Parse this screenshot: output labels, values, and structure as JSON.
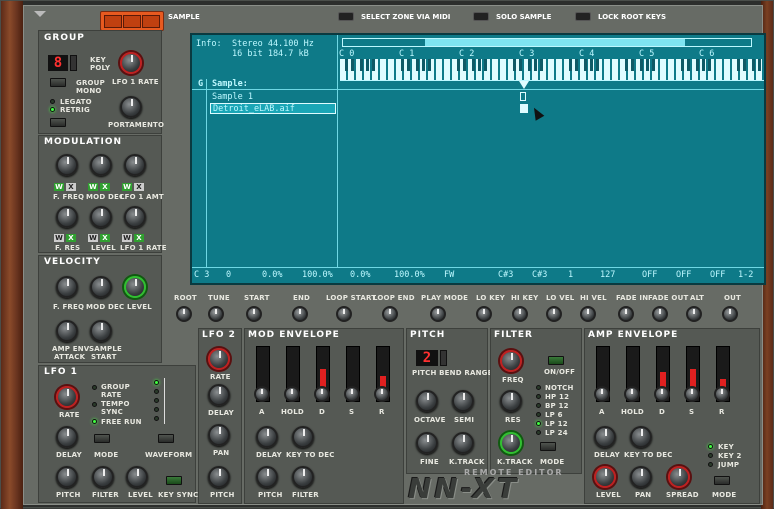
{
  "topbar": {
    "tab_label": "SAMPLE",
    "select_zone_via_midi": "SELECT ZONE VIA MIDI",
    "solo_sample": "SOLO SAMPLE",
    "lock_root_keys": "LOCK ROOT KEYS"
  },
  "group": {
    "title": "GROUP",
    "key_poly_value": "8",
    "key_label": "KEY",
    "poly_label": "POLY",
    "lfo1_rate": "LFO 1 RATE",
    "group_mono_line1": "GROUP",
    "group_mono_line2": "MONO",
    "legato": "LEGATO",
    "retrig": "RETRIG",
    "portamento": "PORTAMENTO"
  },
  "modulation": {
    "title": "MODULATION",
    "row1": [
      "F. FREQ",
      "MOD DEC",
      "LFO 1 AMT"
    ],
    "row2": [
      "F. RES",
      "LEVEL",
      "LFO 1 RATE"
    ],
    "w": "W",
    "x": "X"
  },
  "velocity": {
    "title": "VELOCITY",
    "row1": [
      "F. FREQ",
      "MOD DEC",
      "LEVEL"
    ],
    "amp_env_attack_1": "AMP ENV",
    "amp_env_attack_2": "ATTACK",
    "sample_start_1": "SAMPLE",
    "sample_start_2": "START"
  },
  "lfo1": {
    "title": "LFO 1",
    "group_rate_1": "GROUP",
    "group_rate_2": "RATE",
    "tempo_sync_1": "TEMPO",
    "tempo_sync_2": "SYNC",
    "free_run": "FREE RUN",
    "rate": "RATE",
    "delay": "DELAY",
    "mode": "MODE",
    "waveform": "WAVEFORM",
    "pitch": "PITCH",
    "filter": "FILTER",
    "level": "LEVEL",
    "key_sync": "KEY SYNC"
  },
  "screen": {
    "info_label": "Info:",
    "info_line1": "Stereo 44.100 Hz",
    "info_line2": "16 bit 184.7 kB",
    "g_label": "G",
    "sample_header": "Sample:",
    "samples": [
      "Sample 1",
      "Detroit_eLAB.aif"
    ],
    "octaves": [
      "C 0",
      "C 1",
      "C 2",
      "C 3",
      "C 4",
      "C 5",
      "C 6"
    ],
    "status": [
      "C 3",
      "0",
      "0.0%",
      "100.0%",
      "0.0%",
      "100.0%",
      "FW",
      "C#3",
      "C#3",
      "1",
      "127",
      "OFF",
      "OFF",
      "OFF",
      "1-2"
    ]
  },
  "params": [
    "ROOT",
    "TUNE",
    "START",
    "END",
    "LOOP START",
    "LOOP END",
    "PLAY MODE",
    "LO KEY",
    "HI KEY",
    "LO VEL",
    "HI VEL",
    "FADE IN",
    "FADE OUT",
    "ALT",
    "OUT"
  ],
  "lfo2": {
    "title": "LFO 2",
    "rate": "RATE",
    "delay": "DELAY",
    "pan": "PAN",
    "pitch": "PITCH"
  },
  "mod_env": {
    "title": "MOD ENVELOPE",
    "sliders": [
      "A",
      "HOLD",
      "D",
      "S",
      "R"
    ],
    "slider_levels": [
      0.0,
      0.0,
      0.6,
      0.0,
      0.45
    ],
    "delay": "DELAY",
    "key_to_dec": "KEY TO DEC",
    "pitch": "PITCH",
    "filter": "FILTER"
  },
  "pitch": {
    "title": "PITCH",
    "bend_value": "2",
    "bend_range": "PITCH BEND RANGE",
    "octave": "OCTAVE",
    "semi": "SEMI",
    "fine": "FINE",
    "ktrack": "K.TRACK"
  },
  "filter": {
    "title": "FILTER",
    "freq": "FREQ",
    "on_off": "ON/OFF",
    "res": "RES",
    "ktrack": "K.TRACK",
    "mode": "MODE",
    "types": [
      "NOTCH",
      "HP 12",
      "BP 12",
      "LP 6",
      "LP 12",
      "LP 24"
    ],
    "active_type": "LP 12"
  },
  "amp_env": {
    "title": "AMP ENVELOPE",
    "sliders": [
      "A",
      "HOLD",
      "D",
      "S",
      "R"
    ],
    "slider_levels": [
      0.0,
      0.0,
      0.55,
      0.6,
      0.4
    ],
    "delay": "DELAY",
    "key_to_dec": "KEY TO DEC",
    "level": "LEVEL",
    "pan": "PAN",
    "spread": "SPREAD",
    "mode": "MODE",
    "modes": [
      "KEY",
      "KEY 2",
      "JUMP"
    ]
  },
  "branding": {
    "remote_editor": "REMOTE EDITOR",
    "logo": "NN-XT"
  },
  "colors": {
    "screen_bg": "#0e7a88",
    "screen_text": "#bdf8ff",
    "accent_red": "#e02020",
    "led_green": "#40ff40",
    "tab_orange": "#e85a20"
  }
}
